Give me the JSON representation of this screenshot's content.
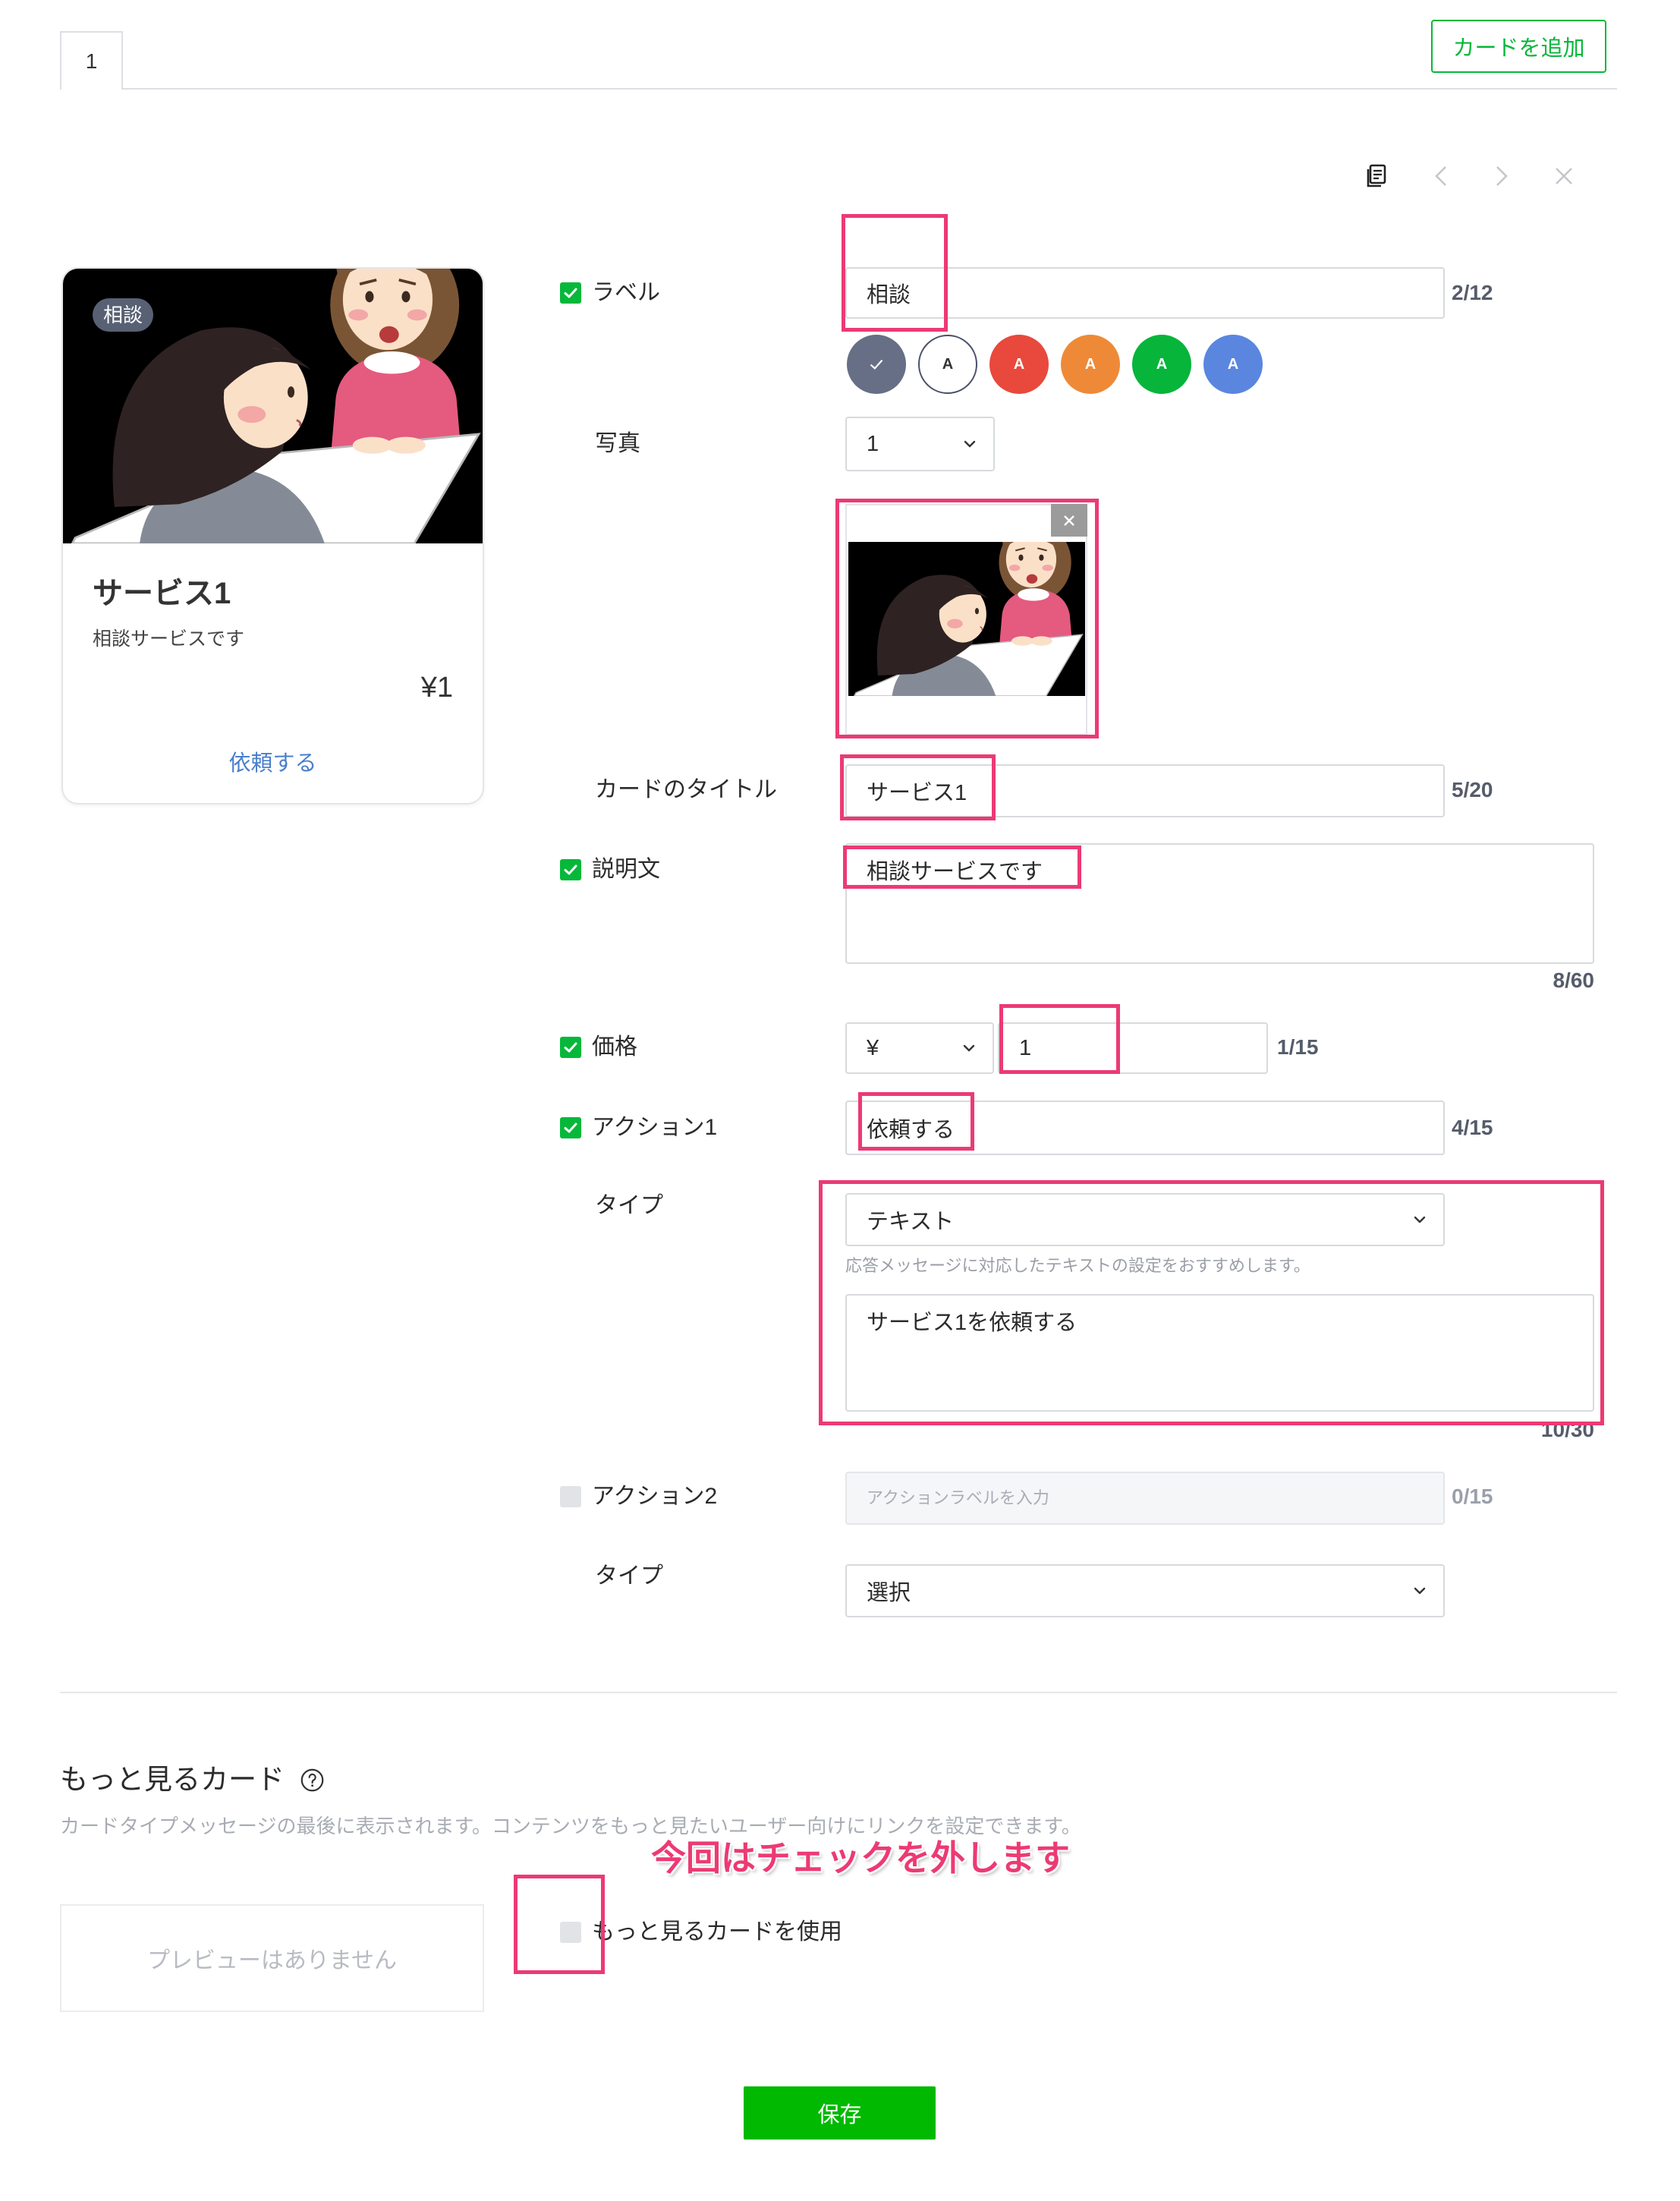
{
  "tabs": [
    {
      "label": "1"
    }
  ],
  "add_card_button": "カードを追加",
  "toolbar": {
    "copy_icon": "copy-icon",
    "prev_icon": "chevron-left-icon",
    "next_icon": "chevron-right-icon",
    "delete_icon": "close-icon"
  },
  "preview": {
    "badge": "相談",
    "title": "サービス1",
    "description": "相談サービスです",
    "price": "¥1",
    "action": "依頼する"
  },
  "form": {
    "label": {
      "name": "ラベル",
      "checked": true,
      "value": "相談",
      "counter": "2/12"
    },
    "label_colors": [
      {
        "color": "#676f86",
        "selected": true
      },
      {
        "letter": "A",
        "color": "#ffffff"
      },
      {
        "letter": "A",
        "color": "#e8493c"
      },
      {
        "letter": "A",
        "color": "#ee8a37"
      },
      {
        "letter": "A",
        "color": "#07b53b"
      },
      {
        "letter": "A",
        "color": "#5a86e0"
      }
    ],
    "photo": {
      "name": "写真",
      "value": "1"
    },
    "title": {
      "name": "カードのタイトル",
      "value": "サービス1",
      "counter": "5/20"
    },
    "description": {
      "name": "説明文",
      "checked": true,
      "value": "相談サービスです",
      "counter": "8/60"
    },
    "price": {
      "name": "価格",
      "checked": true,
      "currency": "¥",
      "value": "1",
      "counter": "1/15"
    },
    "action1": {
      "name": "アクション1",
      "checked": true,
      "value": "依頼する",
      "counter": "4/15",
      "type_label": "タイプ",
      "type_value": "テキスト",
      "hint": "応答メッセージに対応したテキストの設定をおすすめします。",
      "text": "サービス1を依頼する",
      "text_counter": "10/30"
    },
    "action2": {
      "name": "アクション2",
      "checked": false,
      "placeholder": "アクションラベルを入力",
      "counter": "0/15",
      "type_label": "タイプ",
      "type_value": "選択"
    }
  },
  "more_card": {
    "heading": "もっと見るカード",
    "description": "カードタイプメッセージの最後に表示されます。コンテンツをもっと見たいユーザー向けにリンクを設定できます。",
    "preview_empty": "プレビューはありません",
    "checkbox_label": "もっと見るカードを使用",
    "checked": false
  },
  "annotation": {
    "text": "今回はチェックを外します"
  },
  "save_button": "保存",
  "theme": {
    "primary_green": "#06b83a",
    "link_blue": "#4a7fcc",
    "annotation_pink": "#ec3a74"
  }
}
